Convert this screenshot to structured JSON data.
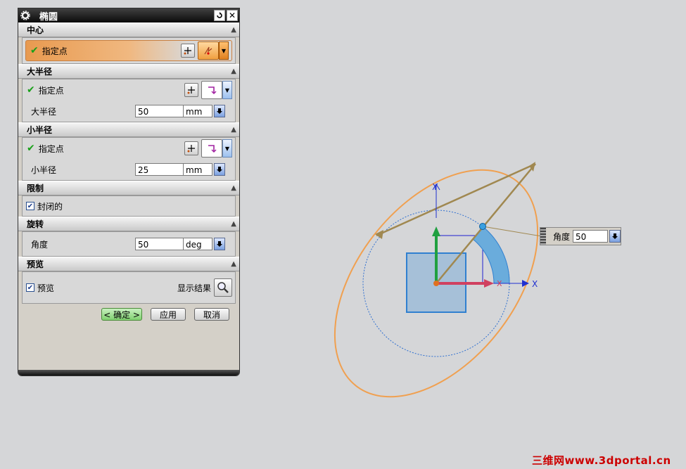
{
  "dialog": {
    "title": "椭圆",
    "sections": {
      "center": {
        "header": "中心",
        "specify_point": "指定点"
      },
      "major": {
        "header": "大半径",
        "specify_point": "指定点",
        "radius_label": "大半径",
        "radius_value": "50",
        "radius_unit": "mm"
      },
      "minor": {
        "header": "小半径",
        "specify_point": "指定点",
        "radius_label": "小半径",
        "radius_value": "25",
        "radius_unit": "mm"
      },
      "limit": {
        "header": "限制",
        "closed_label": "封闭的"
      },
      "rotation": {
        "header": "旋转",
        "angle_label": "角度",
        "angle_value": "50",
        "angle_unit": "deg"
      },
      "preview": {
        "header": "预览",
        "preview_label": "预览",
        "show_result_label": "显示结果"
      }
    },
    "buttons": {
      "ok": "< 确定 >",
      "apply": "应用",
      "cancel": "取消"
    }
  },
  "viewport": {
    "y_axis_label": "Y",
    "x_axis_label": "X",
    "x_axis_label_small": "X",
    "angle_box": {
      "label": "角度",
      "value": "50"
    }
  },
  "watermark": "三维网www.3dportal.cn",
  "colors": {
    "ellipse": "#f0a050",
    "axis_x": "#2030d0",
    "axis_y": "#2030d0",
    "square": "#a6c0d8",
    "arc": "#6aacdc"
  }
}
